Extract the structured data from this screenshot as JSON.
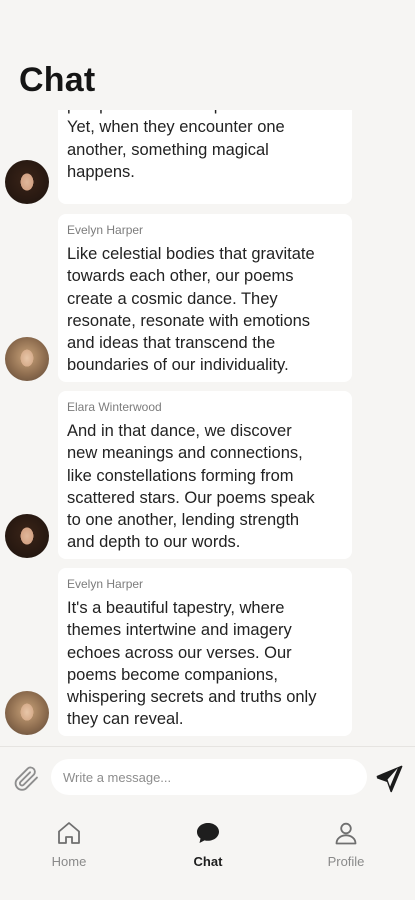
{
  "header": {
    "title": "Chat"
  },
  "messages": [
    {
      "sender": "",
      "text": "perspectives and experiences.\nYet, when they encounter one\nanother, something magical\nhappens.",
      "avatar": "avatar-dark-hair"
    },
    {
      "sender": "Evelyn Harper",
      "text": "Like celestial bodies that gravitate\ntowards each other, our poems\ncreate a cosmic dance. They\nresonate, resonate with emotions\nand ideas that transcend the\nboundaries of our individuality.",
      "avatar": "avatar-light-hair"
    },
    {
      "sender": "Elara Winterwood",
      "text": "And in that dance, we discover\nnew meanings and connections,\nlike constellations forming from\nscattered stars. Our poems speak\nto one another, lending strength\nand depth to our words.",
      "avatar": "avatar-dark-hair"
    },
    {
      "sender": "Evelyn Harper",
      "text": " It's a beautiful tapestry, where\nthemes intertwine and imagery\nechoes across our verses. Our\npoems become companions,\nwhispering secrets and truths only\nthey can reveal.",
      "avatar": "avatar-light-hair"
    }
  ],
  "composer": {
    "placeholder": "Write a message...",
    "attach_icon": "paperclip-icon",
    "send_icon": "send-icon"
  },
  "tabbar": {
    "items": [
      {
        "label": "Home",
        "icon": "home-icon",
        "active": false
      },
      {
        "label": "Chat",
        "icon": "chat-bubble-icon",
        "active": true
      },
      {
        "label": "Profile",
        "icon": "profile-icon",
        "active": false
      }
    ]
  },
  "colors": {
    "background": "#f6f5f3",
    "bubble": "#ffffff",
    "text": "#222222",
    "muted": "#8a8a8a"
  }
}
